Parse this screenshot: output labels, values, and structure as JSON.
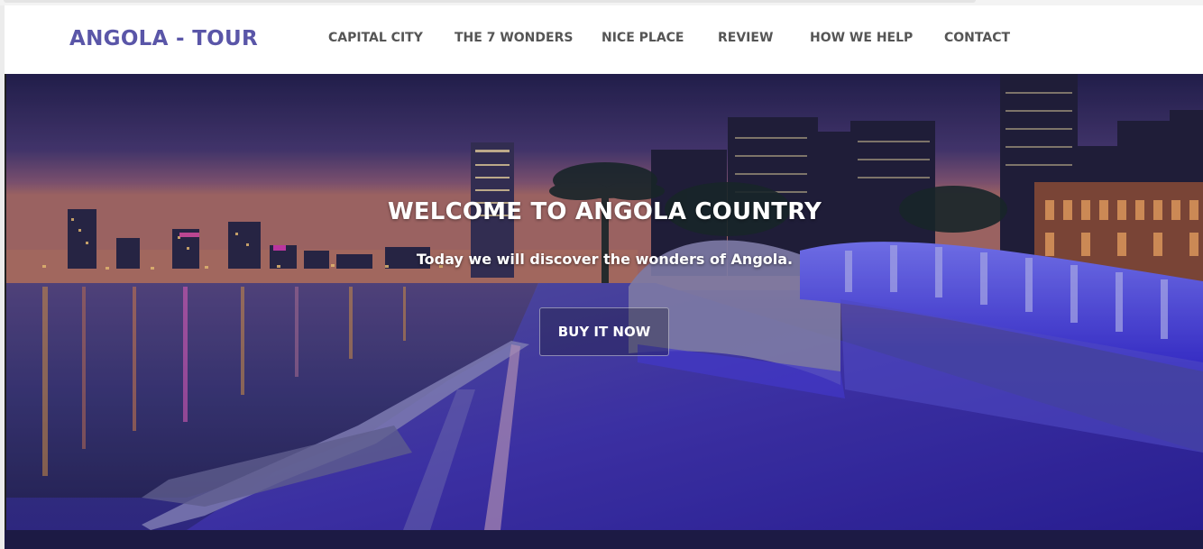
{
  "brand": "ANGOLA - TOUR",
  "nav": {
    "capital_city": "CAPITAL CITY",
    "seven_wonders": "THE 7 WONDERS",
    "nice_place": "NICE PLACE",
    "review": "REVIEW",
    "how_we_help": "HOW WE HELP",
    "contact": "CONTACT"
  },
  "hero": {
    "title": "WELCOME TO ANGOLA COUNTRY",
    "subtitle": "Today we will discover the wonders of Angola.",
    "button_label": "BUY IT NOW",
    "image_description": "night-city-waterfront-bridge"
  },
  "colors": {
    "brand": "#5a56a8",
    "nav_text": "#555555",
    "hero_text": "#ffffff",
    "footer_strip": "#1c1a44"
  }
}
